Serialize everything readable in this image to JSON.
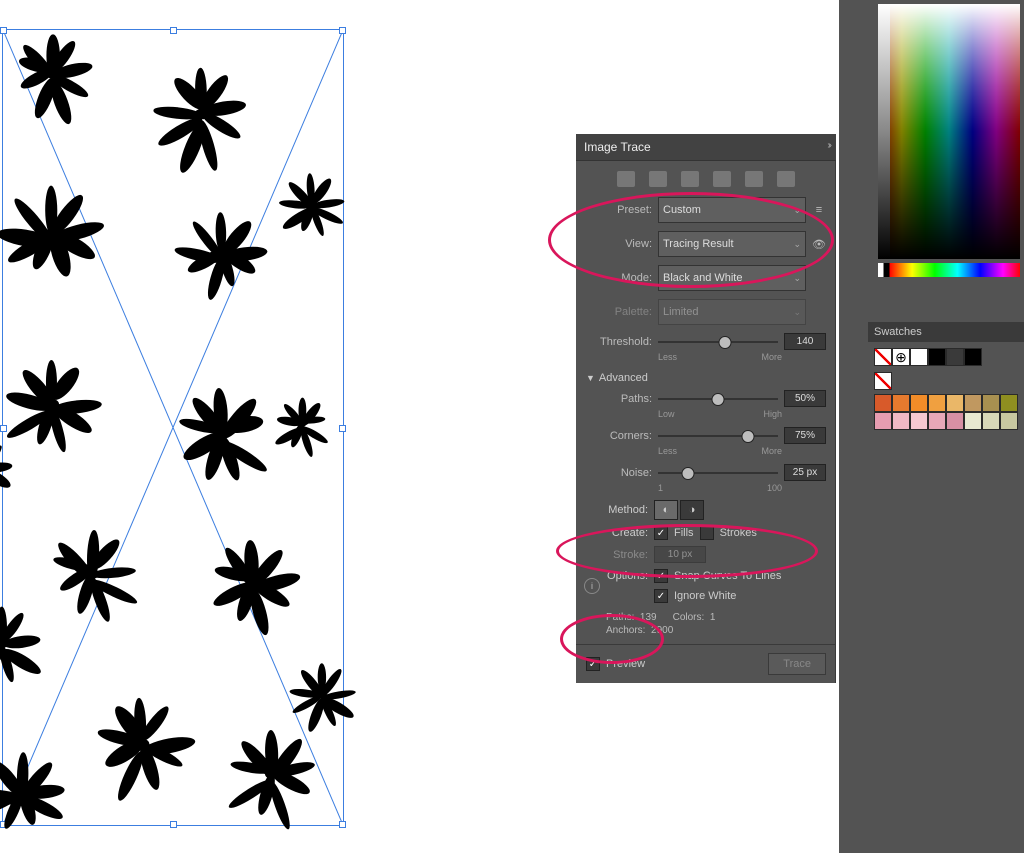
{
  "panel": {
    "title": "Image Trace",
    "preset_label": "Preset:",
    "preset_value": "Custom",
    "view_label": "View:",
    "view_value": "Tracing Result",
    "mode_label": "Mode:",
    "mode_value": "Black and White",
    "palette_label": "Palette:",
    "palette_value": "Limited",
    "threshold_label": "Threshold:",
    "threshold_value": "140",
    "threshold_min": "Less",
    "threshold_max": "More",
    "advanced_label": "Advanced",
    "paths_label": "Paths:",
    "paths_value": "50%",
    "paths_min": "Low",
    "paths_max": "High",
    "corners_label": "Corners:",
    "corners_value": "75%",
    "corners_min": "Less",
    "corners_max": "More",
    "noise_label": "Noise:",
    "noise_value": "25 px",
    "noise_min": "1",
    "noise_max": "100",
    "method_label": "Method:",
    "create_label": "Create:",
    "create_fills": "Fills",
    "create_strokes": "Strokes",
    "stroke_label": "Stroke:",
    "stroke_value": "10 px",
    "options_label": "Options:",
    "opt_snap": "Snap Curves To Lines",
    "opt_ignore": "Ignore White",
    "stat_paths_label": "Paths:",
    "stat_paths": "139",
    "stat_colors_label": "Colors:",
    "stat_colors": "1",
    "stat_anchors_label": "Anchors:",
    "stat_anchors": "2900",
    "preview_label": "Preview",
    "trace_btn": "Trace"
  },
  "swatches": {
    "title": "Swatches",
    "colors_row1": [
      "#ffffff",
      "#000000",
      "#3a3a3a",
      "#000000"
    ],
    "colors_row2": [
      "#d85a2a",
      "#e67a2e",
      "#f28c28",
      "#f0a040",
      "#eab768",
      "#c09860",
      "#a89050",
      "#8f8f20"
    ],
    "colors_row3": [
      "#e79db1",
      "#f0b8c4",
      "#f5c8d0",
      "#e8a8b8",
      "#d890a4",
      "#e8e8d0",
      "#d8d8b8",
      "#c8c8a0"
    ]
  },
  "threshold_pos": "56%",
  "paths_pos": "50%",
  "corners_pos": "75%",
  "noise_pos": "25%"
}
